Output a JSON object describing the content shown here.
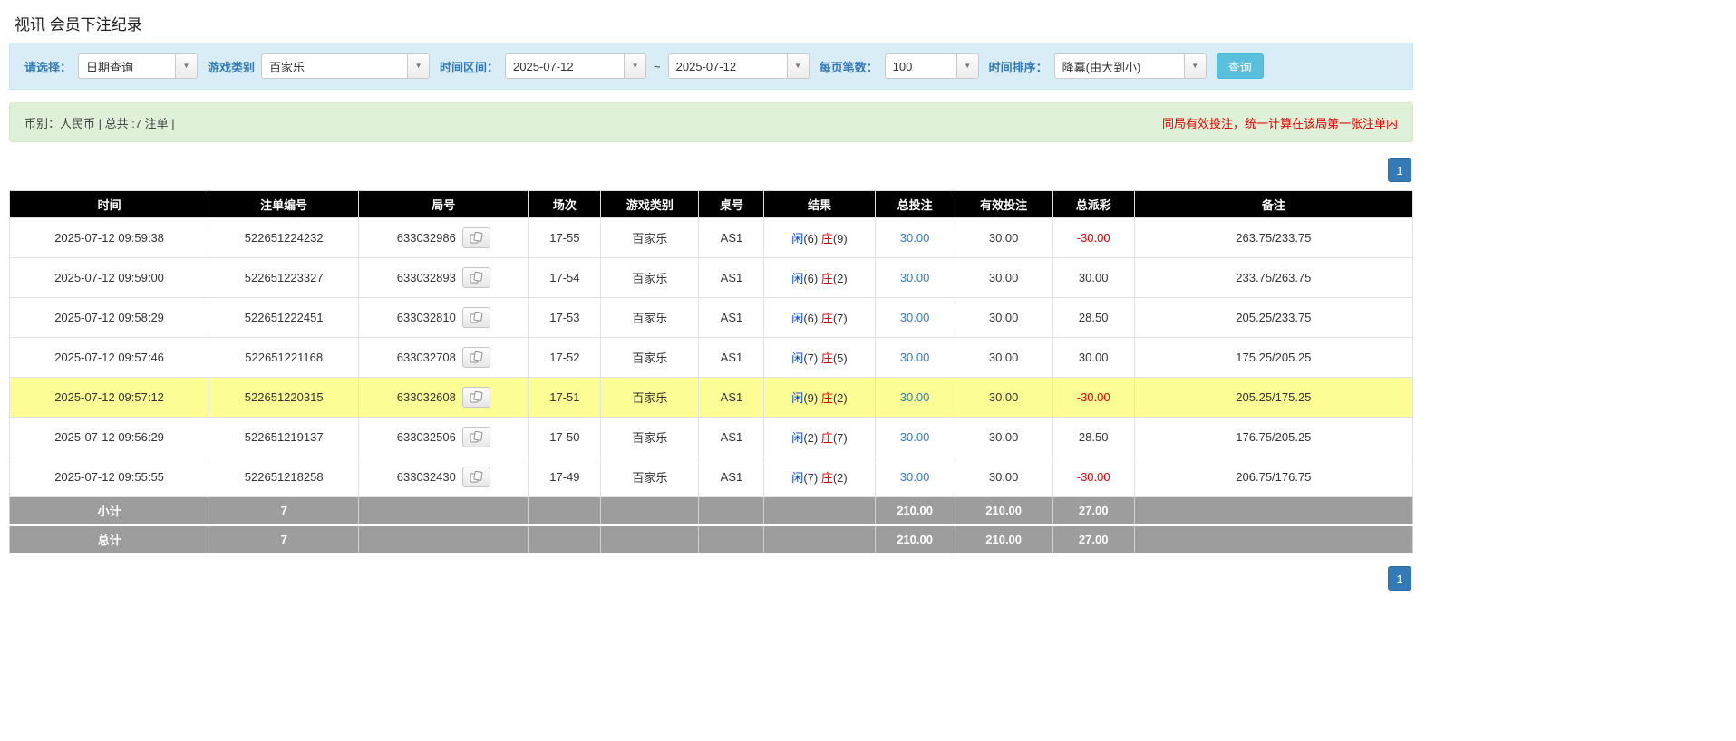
{
  "page": {
    "title": "视讯 会员下注纪录"
  },
  "filters": {
    "select_label": "请选择：",
    "select_value": "日期查询",
    "game_type_label": "游戏类别",
    "game_type_value": "百家乐",
    "time_range_label": "时间区间：",
    "time_from": "2025-07-12",
    "time_separator": "~",
    "time_to": "2025-07-12",
    "page_size_label": "每页笔数：",
    "page_size_value": "100",
    "sort_label": "时间排序：",
    "sort_value": "降冪(由大到小)",
    "search_button": "查询"
  },
  "summary": {
    "info": "币别：人民币 | 总共 :7 注单 |",
    "notice": "同局有效投注，统一计算在该局第一张注单内"
  },
  "pagination": {
    "page": "1"
  },
  "table": {
    "headers": [
      "时间",
      "注单编号",
      "局号",
      "场次",
      "游戏类别",
      "桌号",
      "结果",
      "总投注",
      "有效投注",
      "总派彩",
      "备注"
    ],
    "rows": [
      {
        "time": "2025-07-12 09:59:38",
        "bet_id": "522651224232",
        "round_no": "633032986",
        "session": "17-55",
        "game_type": "百家乐",
        "table_no": "AS1",
        "result": {
          "player": "闲",
          "player_score": "(6)",
          "banker": "庄",
          "banker_score": "(9)"
        },
        "total_bet": "30.00",
        "valid_bet": "30.00",
        "payout": "-30.00",
        "payout_negative": true,
        "remark": "263.75/233.75",
        "highlighted": false
      },
      {
        "time": "2025-07-12 09:59:00",
        "bet_id": "522651223327",
        "round_no": "633032893",
        "session": "17-54",
        "game_type": "百家乐",
        "table_no": "AS1",
        "result": {
          "player": "闲",
          "player_score": "(6)",
          "banker": "庄",
          "banker_score": "(2)"
        },
        "total_bet": "30.00",
        "valid_bet": "30.00",
        "payout": "30.00",
        "payout_negative": false,
        "remark": "233.75/263.75",
        "highlighted": false
      },
      {
        "time": "2025-07-12 09:58:29",
        "bet_id": "522651222451",
        "round_no": "633032810",
        "session": "17-53",
        "game_type": "百家乐",
        "table_no": "AS1",
        "result": {
          "player": "闲",
          "player_score": "(6)",
          "banker": "庄",
          "banker_score": "(7)"
        },
        "total_bet": "30.00",
        "valid_bet": "30.00",
        "payout": "28.50",
        "payout_negative": false,
        "remark": "205.25/233.75",
        "highlighted": false
      },
      {
        "time": "2025-07-12 09:57:46",
        "bet_id": "522651221168",
        "round_no": "633032708",
        "session": "17-52",
        "game_type": "百家乐",
        "table_no": "AS1",
        "result": {
          "player": "闲",
          "player_score": "(7)",
          "banker": "庄",
          "banker_score": "(5)"
        },
        "total_bet": "30.00",
        "valid_bet": "30.00",
        "payout": "30.00",
        "payout_negative": false,
        "remark": "175.25/205.25",
        "highlighted": false
      },
      {
        "time": "2025-07-12 09:57:12",
        "bet_id": "522651220315",
        "round_no": "633032608",
        "session": "17-51",
        "game_type": "百家乐",
        "table_no": "AS1",
        "result": {
          "player": "闲",
          "player_score": "(9)",
          "banker": "庄",
          "banker_score": "(2)"
        },
        "total_bet": "30.00",
        "valid_bet": "30.00",
        "payout": "-30.00",
        "payout_negative": true,
        "remark": "205.25/175.25",
        "highlighted": true
      },
      {
        "time": "2025-07-12 09:56:29",
        "bet_id": "522651219137",
        "round_no": "633032506",
        "session": "17-50",
        "game_type": "百家乐",
        "table_no": "AS1",
        "result": {
          "player": "闲",
          "player_score": "(2)",
          "banker": "庄",
          "banker_score": "(7)"
        },
        "total_bet": "30.00",
        "valid_bet": "30.00",
        "payout": "28.50",
        "payout_negative": false,
        "remark": "176.75/205.25",
        "highlighted": false
      },
      {
        "time": "2025-07-12 09:55:55",
        "bet_id": "522651218258",
        "round_no": "633032430",
        "session": "17-49",
        "game_type": "百家乐",
        "table_no": "AS1",
        "result": {
          "player": "闲",
          "player_score": "(7)",
          "banker": "庄",
          "banker_score": "(2)"
        },
        "total_bet": "30.00",
        "valid_bet": "30.00",
        "payout": "-30.00",
        "payout_negative": true,
        "remark": "206.75/176.75",
        "highlighted": false
      }
    ],
    "subtotal": {
      "label": "小计",
      "count": "7",
      "total_bet": "210.00",
      "valid_bet": "210.00",
      "payout": "27.00"
    },
    "total": {
      "label": "总计",
      "count": "7",
      "total_bet": "210.00",
      "valid_bet": "210.00",
      "payout": "27.00"
    }
  },
  "colors": {
    "accent": "#337ab7",
    "button": "#5bc0de",
    "header-bg": "#000000",
    "highlight": "#fdfd96",
    "player-blue": "#0044cc",
    "banker-red": "#d60000",
    "negative-red": "#e60000",
    "notice-red": "#e60000",
    "filter-bg": "#d9edf7",
    "summary-bg": "#dff0d8",
    "footer-bg": "#9d9d9d"
  }
}
